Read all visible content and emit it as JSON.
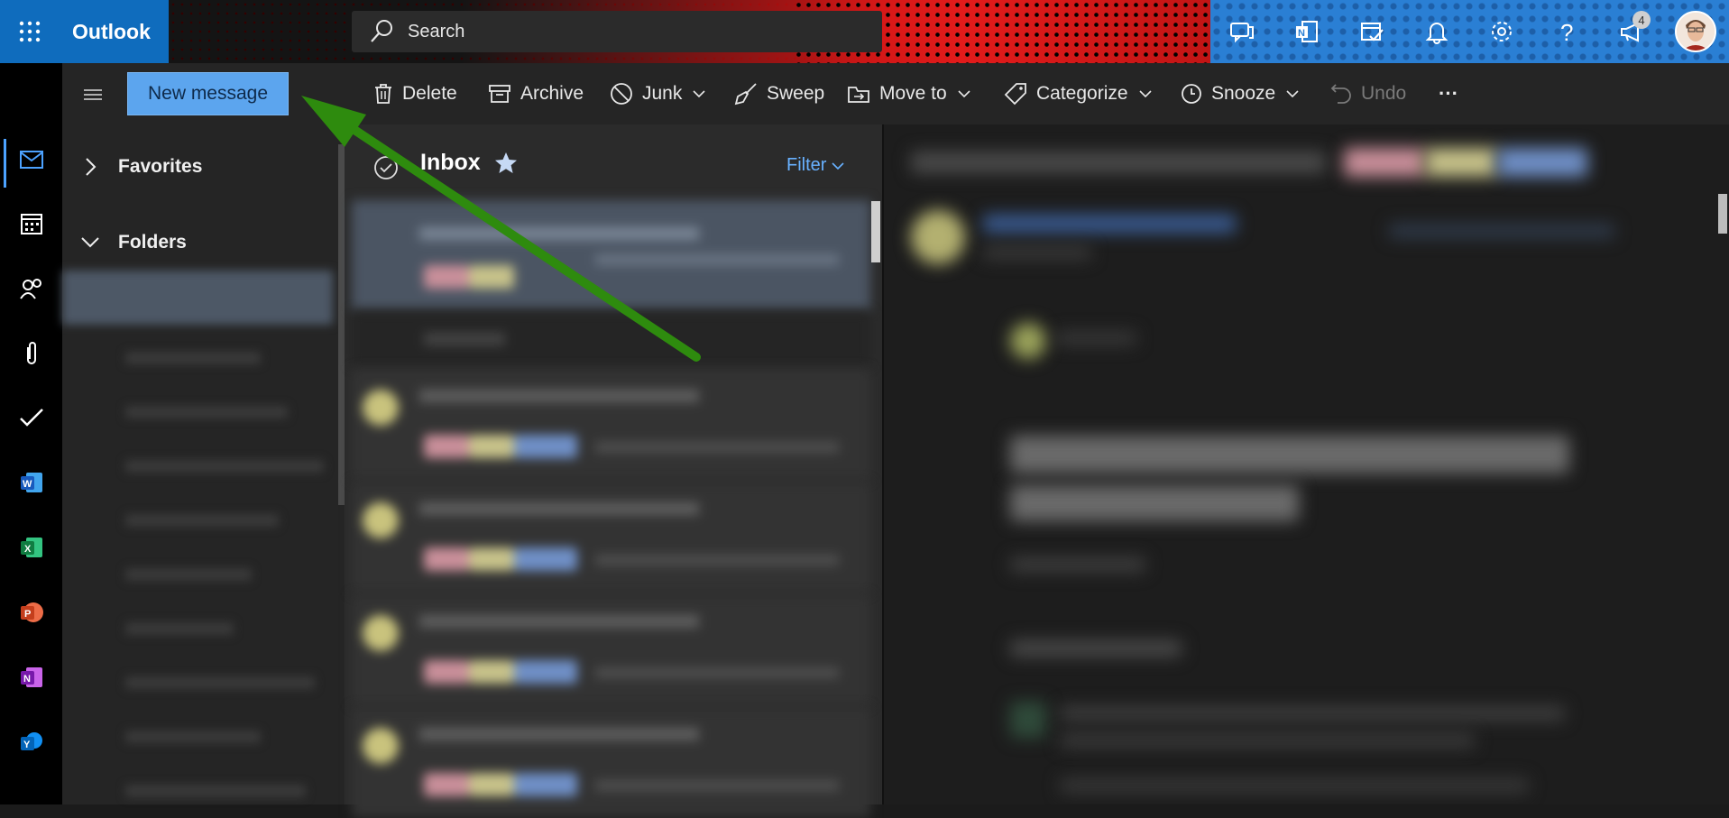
{
  "app": {
    "name": "Outlook"
  },
  "search": {
    "placeholder": "Search"
  },
  "header": {
    "notification_count": "4"
  },
  "nav": {
    "new_message": "New message",
    "favorites": "Favorites",
    "folders": "Folders"
  },
  "toolbar": {
    "delete": "Delete",
    "archive": "Archive",
    "junk": "Junk",
    "sweep": "Sweep",
    "move_to": "Move to",
    "categorize": "Categorize",
    "snooze": "Snooze",
    "undo": "Undo",
    "more": "···"
  },
  "list": {
    "title": "Inbox",
    "filter": "Filter"
  },
  "colors": {
    "brand": "#0f6cbd",
    "accent_button": "#5ca5ee",
    "filter_link": "#68b1ff",
    "annotation_arrow": "#2e8b0e"
  },
  "icons": {
    "rail": [
      "mail-icon",
      "calendar-icon",
      "people-icon",
      "attachment-icon",
      "todo-icon",
      "word-icon",
      "excel-icon",
      "powerpoint-icon",
      "onenote-icon",
      "yammer-icon"
    ],
    "header": [
      "chat-icon",
      "onenote-header-icon",
      "calendar-check-icon",
      "bell-icon",
      "gear-icon",
      "help-icon",
      "megaphone-icon"
    ]
  }
}
